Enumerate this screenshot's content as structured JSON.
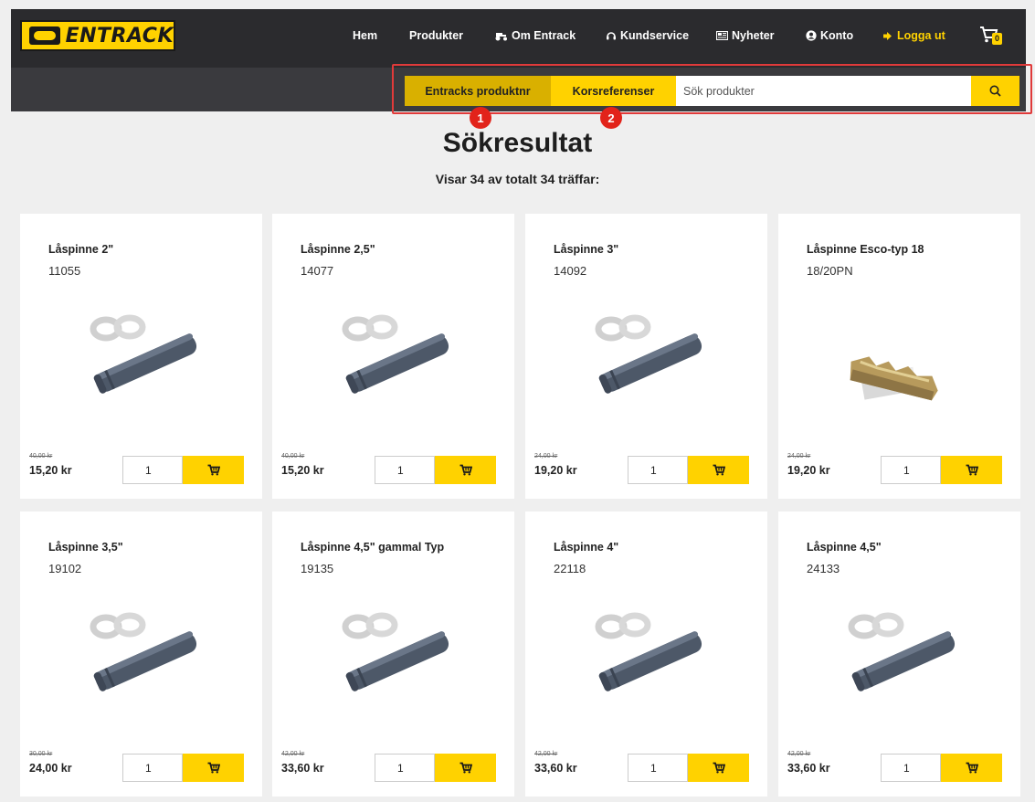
{
  "header": {
    "logo_text": "ENTRACK",
    "nav": [
      {
        "label": "Hem",
        "icon": ""
      },
      {
        "label": "Produkter",
        "icon": ""
      },
      {
        "label": "Om Entrack",
        "icon": "tractor-icon"
      },
      {
        "label": "Kundservice",
        "icon": "headset-icon"
      },
      {
        "label": "Nyheter",
        "icon": "newspaper-icon"
      },
      {
        "label": "Konto",
        "icon": "user-circle-icon"
      },
      {
        "label": "Logga ut",
        "icon": "sign-out-icon"
      }
    ],
    "cart_count": "0",
    "accent_color": "#ffd200"
  },
  "search": {
    "tab_product_number": "Entracks produktnr",
    "tab_cross_reference": "Korsreferenser",
    "placeholder": "Sök produkter",
    "markers": [
      "1",
      "2"
    ]
  },
  "results": {
    "title": "Sökresultat",
    "count_text": "Visar 34 av totalt 34 träffar:"
  },
  "products": [
    {
      "name": "Låspinne 2\"",
      "sku": "11055",
      "old_price": "40,00 kr",
      "price": "15,20 kr",
      "qty": "1",
      "image": "pin-icon"
    },
    {
      "name": "Låspinne 2,5\"",
      "sku": "14077",
      "old_price": "40,00 kr",
      "price": "15,20 kr",
      "qty": "1",
      "image": "pin-icon"
    },
    {
      "name": "Låspinne 3\"",
      "sku": "14092",
      "old_price": "24,00 kr",
      "price": "19,20 kr",
      "qty": "1",
      "image": "pin-icon"
    },
    {
      "name": "Låspinne Esco-typ 18",
      "sku": "18/20PN",
      "old_price": "24,00 kr",
      "price": "19,20 kr",
      "qty": "1",
      "image": "esco-pin-icon"
    },
    {
      "name": "Låspinne 3,5\"",
      "sku": "19102",
      "old_price": "30,00 kr",
      "price": "24,00 kr",
      "qty": "1",
      "image": "pin-icon"
    },
    {
      "name": "Låspinne 4,5\" gammal Typ",
      "sku": "19135",
      "old_price": "42,00 kr",
      "price": "33,60 kr",
      "qty": "1",
      "image": "pin-icon"
    },
    {
      "name": "Låspinne 4\"",
      "sku": "22118",
      "old_price": "42,00 kr",
      "price": "33,60 kr",
      "qty": "1",
      "image": "pin-icon"
    },
    {
      "name": "Låspinne 4,5\"",
      "sku": "24133",
      "old_price": "42,00 kr",
      "price": "33,60 kr",
      "qty": "1",
      "image": "pin-icon"
    }
  ]
}
